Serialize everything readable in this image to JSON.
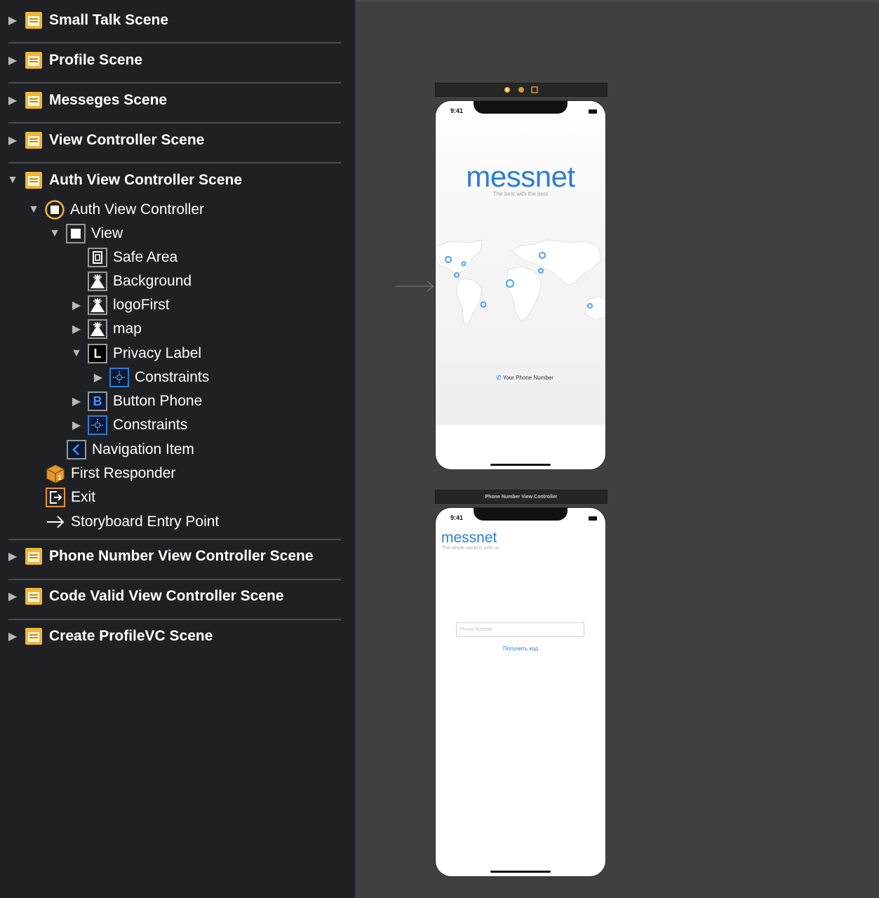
{
  "outline": {
    "scenes_top": [
      {
        "label": "Small Talk Scene"
      },
      {
        "label": "Profile Scene"
      },
      {
        "label": "Messeges Scene"
      },
      {
        "label": "View Controller Scene"
      }
    ],
    "auth_scene": {
      "label": "Auth View Controller Scene",
      "controller": "Auth View Controller",
      "view": "View",
      "safe_area": "Safe Area",
      "background": "Background",
      "logo_first": "logoFirst",
      "map": "map",
      "privacy_label": "Privacy Label",
      "privacy_constraints": "Constraints",
      "button_phone": "Button Phone",
      "view_constraints": "Constraints",
      "navigation_item": "Navigation Item",
      "first_responder": "First Responder",
      "exit": "Exit",
      "entry_point": "Storyboard Entry Point"
    },
    "scenes_bottom": [
      {
        "label": "Phone Number View Controller Scene"
      },
      {
        "label": "Code Valid View Controller Scene"
      },
      {
        "label": "Create ProfileVC Scene"
      }
    ],
    "icon_glyphs": {
      "label_icon": "L",
      "button_icon": "B"
    }
  },
  "canvas": {
    "auth_screen": {
      "status_time": "9:41",
      "logo": "messnet",
      "tagline": "The best with the best",
      "phone_button": "Your Phone Number"
    },
    "phone_screen": {
      "title_bar": "Phone Number View Controller",
      "status_time": "9:41",
      "logo": "messnet",
      "tagline": "The whole world is with us",
      "phone_placeholder": "Phone Number",
      "get_code_button": "Получить код"
    }
  },
  "colors": {
    "sidebar_bg": "#1f2024",
    "canvas_bg": "#404040",
    "scene_icon": "#f0b53a",
    "accent_blue": "#2d7dd2"
  }
}
